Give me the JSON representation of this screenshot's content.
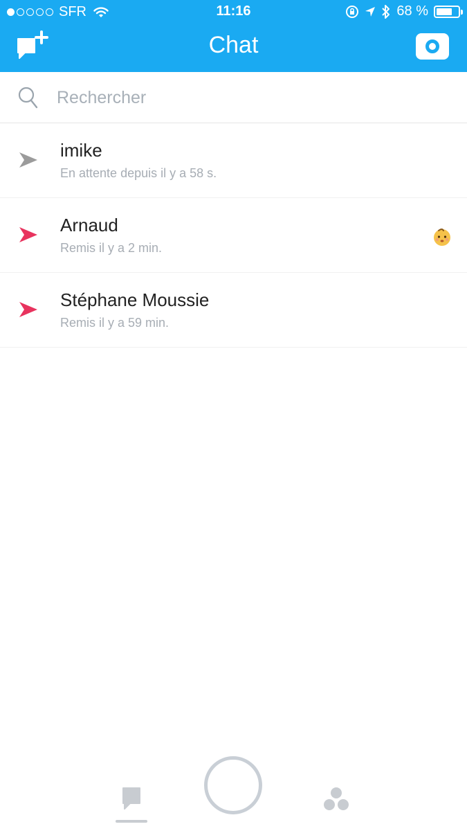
{
  "status_bar": {
    "carrier": "SFR",
    "time": "11:16",
    "battery": "68 %",
    "battery_level": 0.68,
    "signal_dots_filled": 1,
    "signal_dots_total": 5
  },
  "nav": {
    "title": "Chat"
  },
  "search": {
    "placeholder": "Rechercher"
  },
  "chats": [
    {
      "name": "imike",
      "status": "En attente depuis il y a 58 s.",
      "arrow_color": "#9b9b9b",
      "emoji": ""
    },
    {
      "name": "Arnaud",
      "status": "Remis il y a 2 min.",
      "arrow_color": "#e8335e",
      "emoji": "baby-face-icon"
    },
    {
      "name": "Stéphane Moussie",
      "status": "Remis il y a 59 min.",
      "arrow_color": "#e8335e",
      "emoji": ""
    }
  ],
  "colors": {
    "header": "#1aaaf2",
    "sent_unopened": "#9b9b9b",
    "delivered": "#e8335e",
    "tab_inactive": "#c8ccd1"
  }
}
